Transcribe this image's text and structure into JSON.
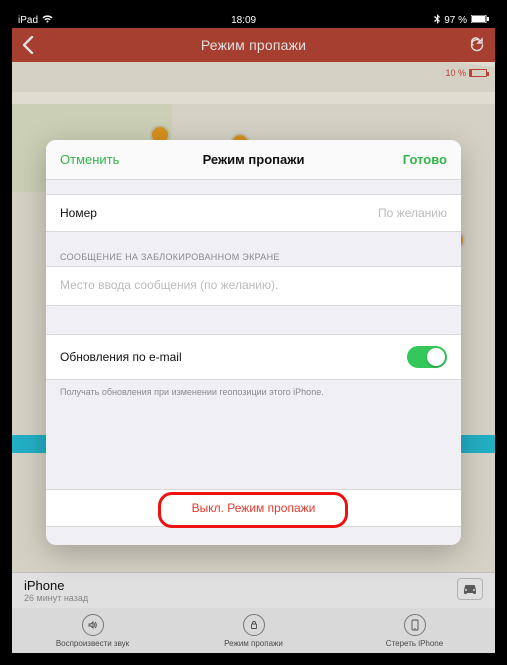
{
  "statusbar": {
    "device": "iPad",
    "time": "18:09",
    "battery": "97 %"
  },
  "nav": {
    "title": "Режим пропажи"
  },
  "map": {
    "battery_pct": "10 %"
  },
  "modal": {
    "cancel": "Отменить",
    "title": "Режим пропажи",
    "done": "Готово",
    "number_label": "Номер",
    "number_placeholder": "По желанию",
    "msg_section": "СООБЩЕНИЕ НА ЗАБЛОКИРОВАННОМ ЭКРАНЕ",
    "msg_placeholder": "Место ввода сообщения (по желанию).",
    "email_updates_label": "Обновления по e-mail",
    "email_updates_note": "Получать обновления при изменении геопозиции этого iPhone.",
    "off_button": "Выкл. Режим пропажи"
  },
  "device_card": {
    "name": "iPhone",
    "time": "26 минут назад"
  },
  "actions": {
    "sound": "Воспроизвести звук",
    "lost": "Режим пропажи",
    "erase": "Стереть iPhone"
  }
}
